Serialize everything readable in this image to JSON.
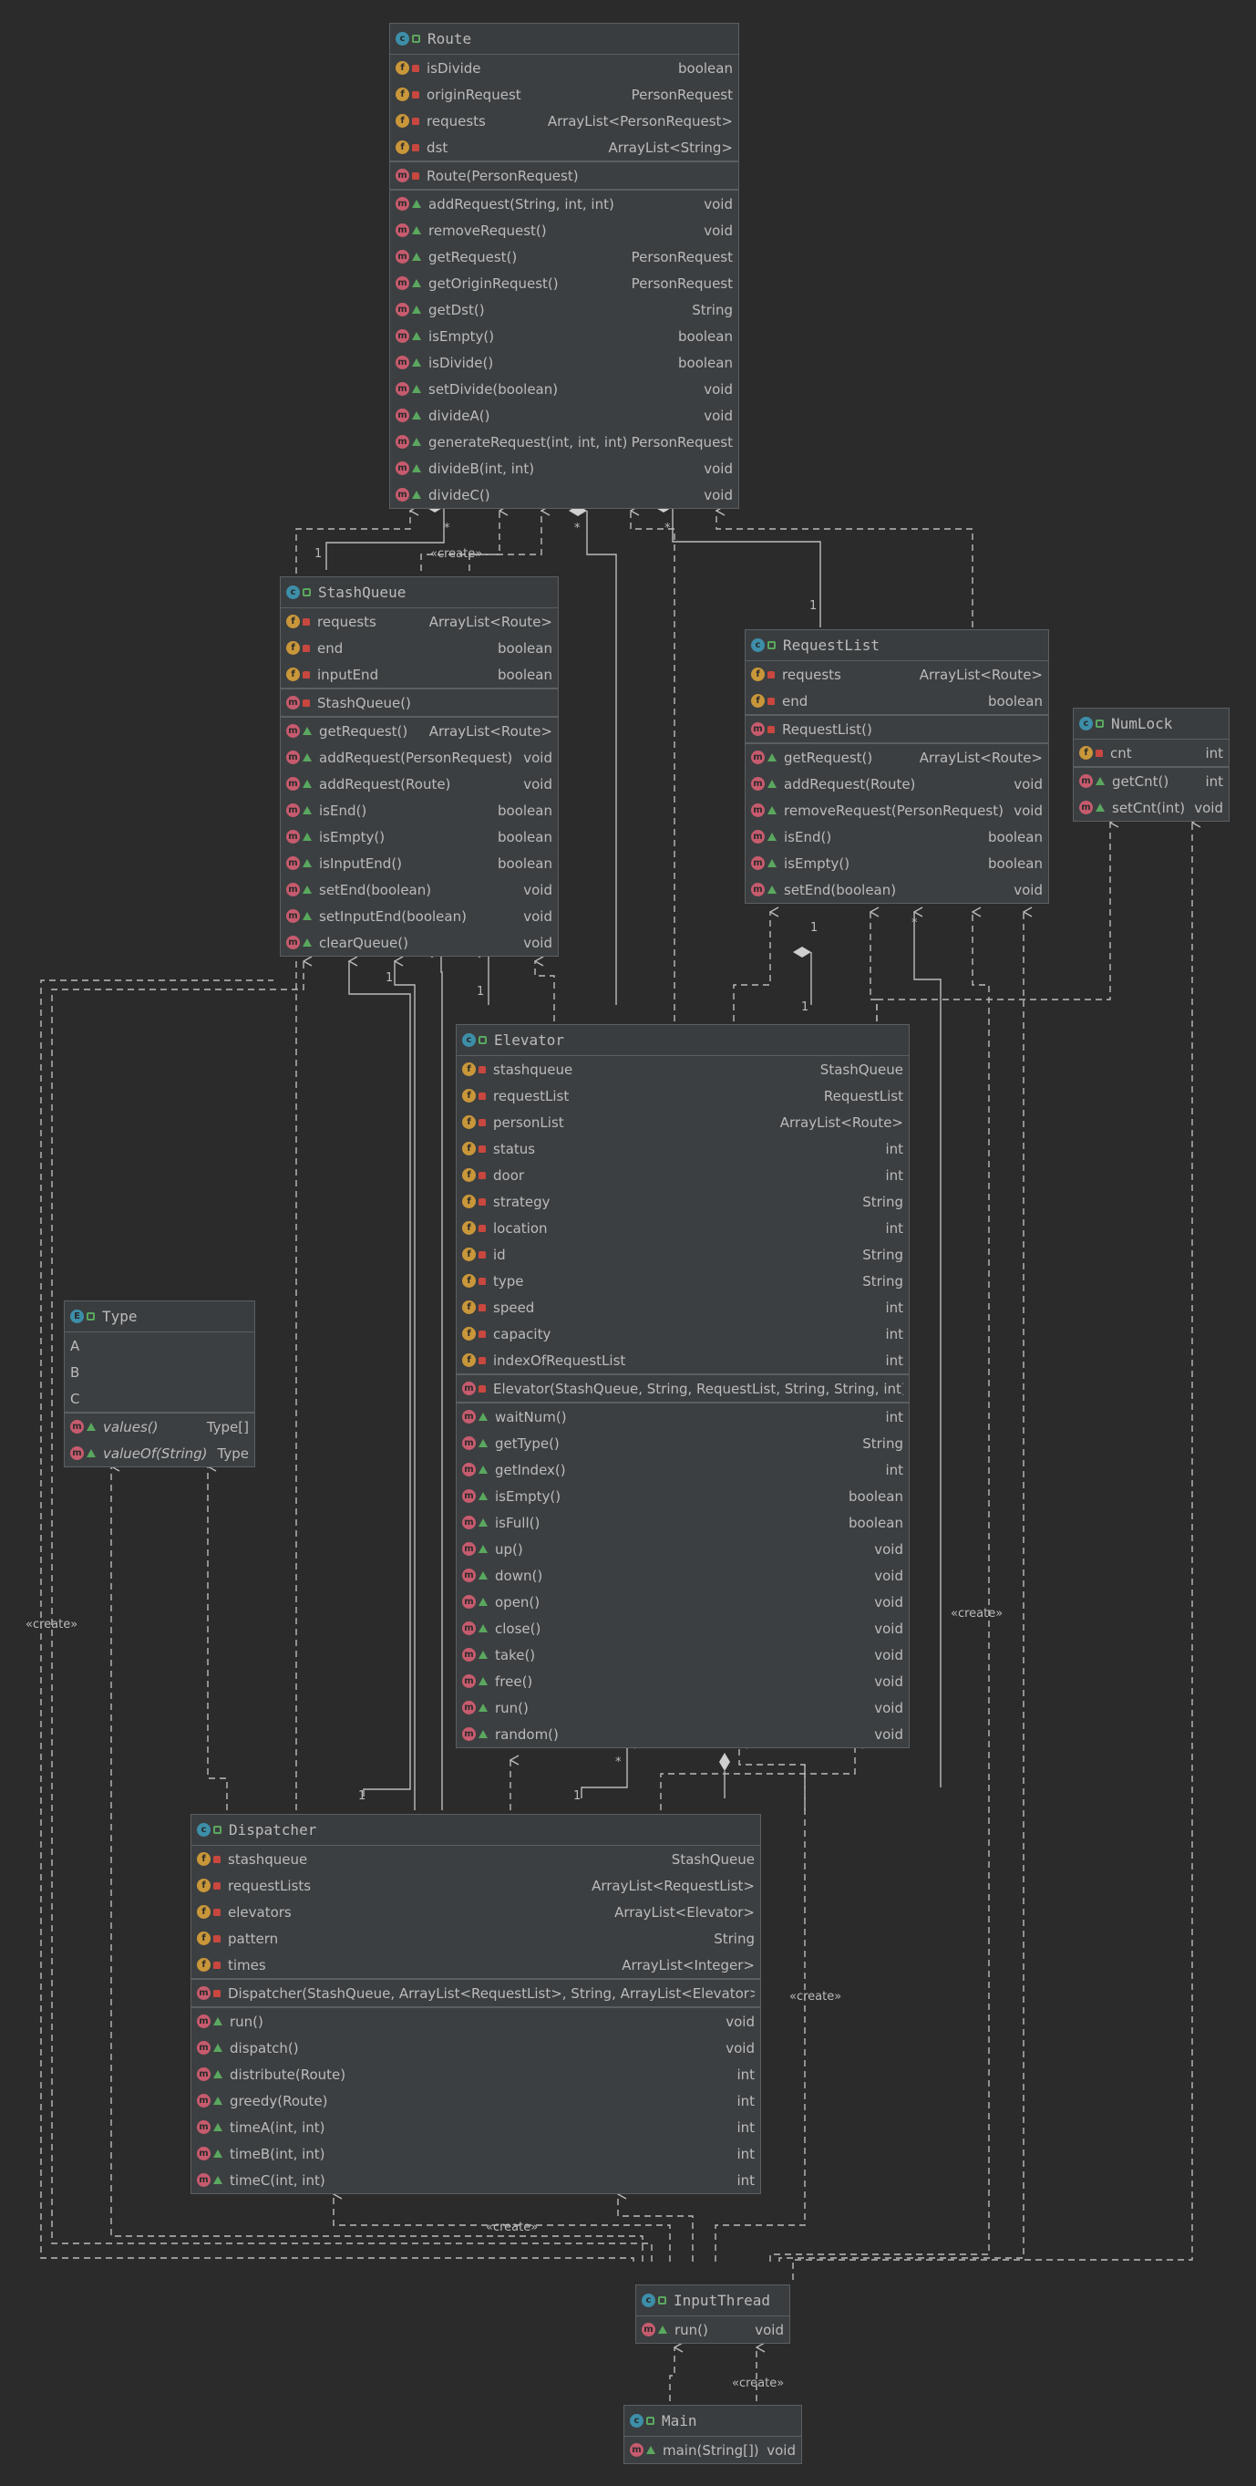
{
  "classes": {
    "route": {
      "name": "Route",
      "fields": [
        {
          "name": "isDivide",
          "type": "boolean"
        },
        {
          "name": "originRequest",
          "type": "PersonRequest"
        },
        {
          "name": "requests",
          "type": "ArrayList<PersonRequest>"
        },
        {
          "name": "dst",
          "type": "ArrayList<String>"
        }
      ],
      "constructor": "Route(PersonRequest)",
      "methods": [
        {
          "name": "addRequest(String, int, int)",
          "type": "void"
        },
        {
          "name": "removeRequest()",
          "type": "void"
        },
        {
          "name": "getRequest()",
          "type": "PersonRequest"
        },
        {
          "name": "getOriginRequest()",
          "type": "PersonRequest"
        },
        {
          "name": "getDst()",
          "type": "String"
        },
        {
          "name": "isEmpty()",
          "type": "boolean"
        },
        {
          "name": "isDivide()",
          "type": "boolean"
        },
        {
          "name": "setDivide(boolean)",
          "type": "void"
        },
        {
          "name": "divideA()",
          "type": "void"
        },
        {
          "name": "generateRequest(int, int, int)",
          "type": "PersonRequest"
        },
        {
          "name": "divideB(int, int)",
          "type": "void"
        },
        {
          "name": "divideC()",
          "type": "void"
        }
      ]
    },
    "stashqueue": {
      "name": "StashQueue",
      "fields": [
        {
          "name": "requests",
          "type": "ArrayList<Route>"
        },
        {
          "name": "end",
          "type": "boolean"
        },
        {
          "name": "inputEnd",
          "type": "boolean"
        }
      ],
      "constructor": "StashQueue()",
      "methods": [
        {
          "name": "getRequest()",
          "type": "ArrayList<Route>"
        },
        {
          "name": "addRequest(PersonRequest)",
          "type": "void"
        },
        {
          "name": "addRequest(Route)",
          "type": "void"
        },
        {
          "name": "isEnd()",
          "type": "boolean"
        },
        {
          "name": "isEmpty()",
          "type": "boolean"
        },
        {
          "name": "isInputEnd()",
          "type": "boolean"
        },
        {
          "name": "setEnd(boolean)",
          "type": "void"
        },
        {
          "name": "setInputEnd(boolean)",
          "type": "void"
        },
        {
          "name": "clearQueue()",
          "type": "void"
        }
      ]
    },
    "requestlist": {
      "name": "RequestList",
      "fields": [
        {
          "name": "requests",
          "type": "ArrayList<Route>"
        },
        {
          "name": "end",
          "type": "boolean"
        }
      ],
      "constructor": "RequestList()",
      "methods": [
        {
          "name": "getRequest()",
          "type": "ArrayList<Route>"
        },
        {
          "name": "addRequest(Route)",
          "type": "void"
        },
        {
          "name": "removeRequest(PersonRequest)",
          "type": "void"
        },
        {
          "name": "isEnd()",
          "type": "boolean"
        },
        {
          "name": "isEmpty()",
          "type": "boolean"
        },
        {
          "name": "setEnd(boolean)",
          "type": "void"
        }
      ]
    },
    "numlock": {
      "name": "NumLock",
      "fields": [
        {
          "name": "cnt",
          "type": "int"
        }
      ],
      "methods": [
        {
          "name": "getCnt()",
          "type": "int"
        },
        {
          "name": "setCnt(int)",
          "type": "void"
        }
      ]
    },
    "elevator": {
      "name": "Elevator",
      "fields": [
        {
          "name": "stashqueue",
          "type": "StashQueue"
        },
        {
          "name": "requestList",
          "type": "RequestList"
        },
        {
          "name": "personList",
          "type": "ArrayList<Route>"
        },
        {
          "name": "status",
          "type": "int"
        },
        {
          "name": "door",
          "type": "int"
        },
        {
          "name": "strategy",
          "type": "String"
        },
        {
          "name": "location",
          "type": "int"
        },
        {
          "name": "id",
          "type": "String"
        },
        {
          "name": "type",
          "type": "String"
        },
        {
          "name": "speed",
          "type": "int"
        },
        {
          "name": "capacity",
          "type": "int"
        },
        {
          "name": "indexOfRequestList",
          "type": "int"
        }
      ],
      "constructor": "Elevator(StashQueue, String, RequestList, String, String, int)",
      "methods": [
        {
          "name": "waitNum()",
          "type": "int"
        },
        {
          "name": "getType()",
          "type": "String"
        },
        {
          "name": "getIndex()",
          "type": "int"
        },
        {
          "name": "isEmpty()",
          "type": "boolean"
        },
        {
          "name": "isFull()",
          "type": "boolean"
        },
        {
          "name": "up()",
          "type": "void"
        },
        {
          "name": "down()",
          "type": "void"
        },
        {
          "name": "open()",
          "type": "void"
        },
        {
          "name": "close()",
          "type": "void"
        },
        {
          "name": "take()",
          "type": "void"
        },
        {
          "name": "free()",
          "type": "void"
        },
        {
          "name": "run()",
          "type": "void"
        },
        {
          "name": "random()",
          "type": "void"
        }
      ]
    },
    "type": {
      "name": "Type",
      "constants": [
        "A",
        "B",
        "C"
      ],
      "methods": [
        {
          "name": "values()",
          "type": "Type[]"
        },
        {
          "name": "valueOf(String)",
          "type": "Type"
        }
      ]
    },
    "dispatcher": {
      "name": "Dispatcher",
      "fields": [
        {
          "name": "stashqueue",
          "type": "StashQueue"
        },
        {
          "name": "requestLists",
          "type": "ArrayList<RequestList>"
        },
        {
          "name": "elevators",
          "type": "ArrayList<Elevator>"
        },
        {
          "name": "pattern",
          "type": "String"
        },
        {
          "name": "times",
          "type": "ArrayList<Integer>"
        }
      ],
      "constructor": "Dispatcher(StashQueue, ArrayList<RequestList>, String, ArrayList<Elevator>)",
      "methods": [
        {
          "name": "run()",
          "type": "void"
        },
        {
          "name": "dispatch()",
          "type": "void"
        },
        {
          "name": "distribute(Route)",
          "type": "int"
        },
        {
          "name": "greedy(Route)",
          "type": "int"
        },
        {
          "name": "timeA(int, int)",
          "type": "int"
        },
        {
          "name": "timeB(int, int)",
          "type": "int"
        },
        {
          "name": "timeC(int, int)",
          "type": "int"
        }
      ]
    },
    "inputthread": {
      "name": "InputThread",
      "methods": [
        {
          "name": "run()",
          "type": "void"
        }
      ]
    },
    "main": {
      "name": "Main",
      "methods": [
        {
          "name": "main(String[])",
          "type": "void"
        }
      ]
    }
  },
  "labels": {
    "create": "«create»",
    "one": "1",
    "many": "*"
  }
}
